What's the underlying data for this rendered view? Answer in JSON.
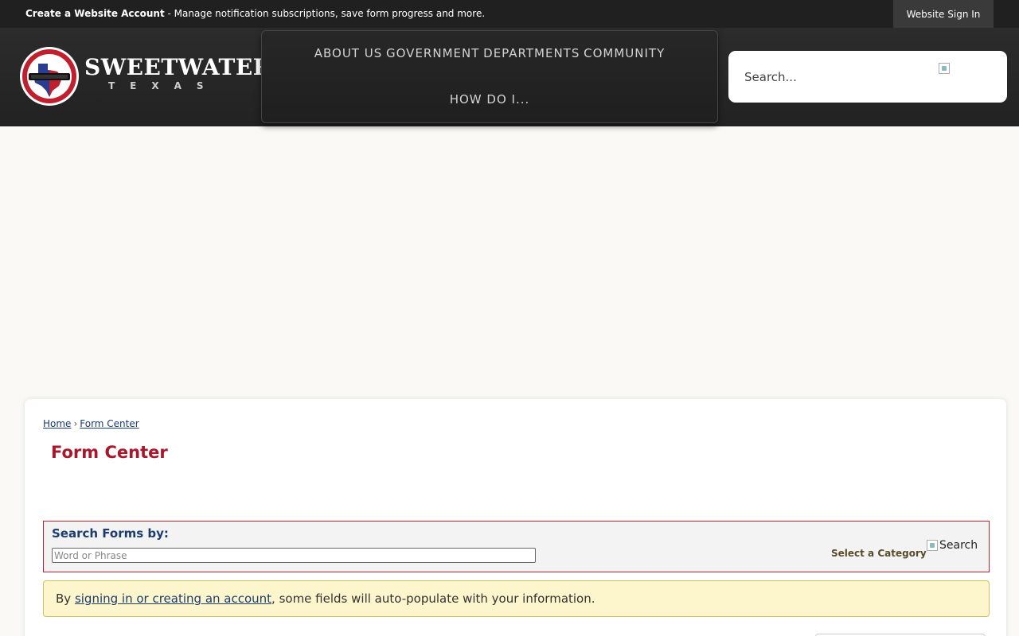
{
  "topbar": {
    "account_link": "Create a Website Account",
    "account_message": " - Manage notification subscriptions, save form progress and more.",
    "signin_label": "Website Sign In"
  },
  "header": {
    "brand_name": "SWEETWATER",
    "brand_sub": "TEXAS",
    "nav": [
      {
        "label": "ABOUT US"
      },
      {
        "label": "GOVERNMENT"
      },
      {
        "label": "DEPARTMENTS"
      },
      {
        "label": "COMMUNITY"
      },
      {
        "label": "HOW DO I..."
      }
    ],
    "search": {
      "placeholder": "Search..."
    }
  },
  "breadcrumb": {
    "home": "Home",
    "separator": "›",
    "current": "Form Center"
  },
  "page": {
    "title": "Form Center"
  },
  "search_forms": {
    "label": "Search Forms by:",
    "placeholder": "Word or Phrase",
    "category_label": "Select a Category",
    "search_button": "Search"
  },
  "notice": {
    "prefix": "By ",
    "link": "signing in or creating an account",
    "suffix": ", some fields will auto-populate with your information."
  },
  "colors": {
    "topbar": "#202020",
    "header": "#262626",
    "title_red": "#a8172c",
    "link_blue": "#1a3d6d",
    "notice_bg": "#fdf5cc"
  },
  "icons": [
    "city-seal-logo",
    "search-icon",
    "broken-image-icon"
  ]
}
